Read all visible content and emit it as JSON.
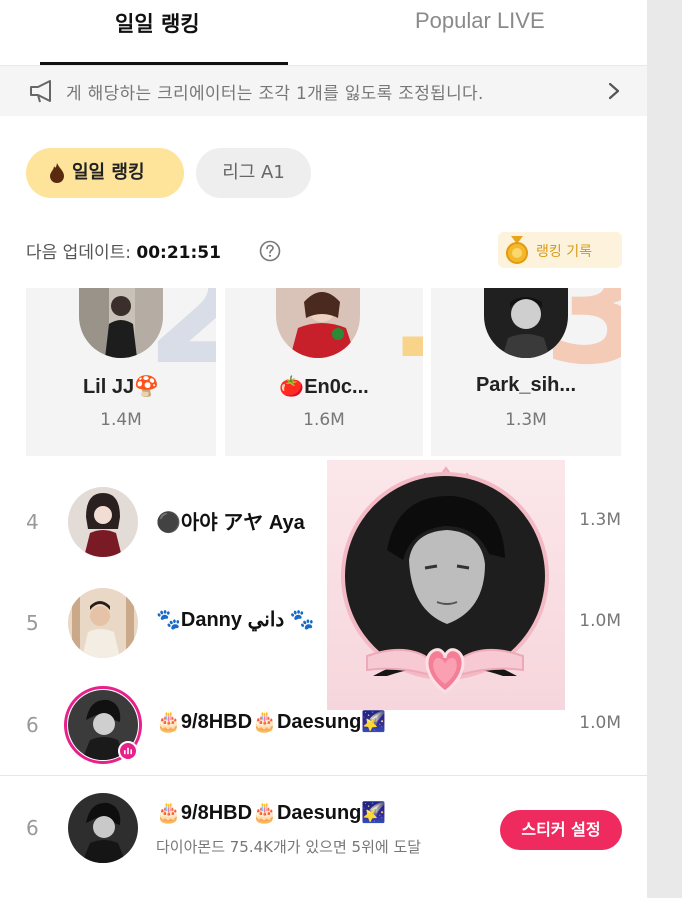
{
  "tabs": {
    "daily": "일일 랭킹",
    "popular": "Popular LIVE"
  },
  "notice": {
    "text": "게 해당하는 크리에이터는 조각 1개를 잃도록 조정됩니다."
  },
  "chips": {
    "daily": "일일 랭킹",
    "league": "리그 A1"
  },
  "update": {
    "label": "다음 업데이트:",
    "time": "00:21:51"
  },
  "ranking_record": "랭킹 기록",
  "top3": [
    {
      "rank": "2",
      "name": "Lil JJ🍄",
      "score": "1.4M"
    },
    {
      "rank": "1",
      "name": "🍅En0c...",
      "score": "1.6M"
    },
    {
      "rank": "3",
      "name": "Park_sih...",
      "score": "1.3M"
    }
  ],
  "rows": [
    {
      "rank": "4",
      "name": "⚫아야 アヤ Aya",
      "score": "1.3M"
    },
    {
      "rank": "5",
      "name": "🐾Danny داني 🐾",
      "score": "1.0M"
    },
    {
      "rank": "6",
      "name": "🎂9/8HBD🎂Daesung🌠",
      "score": "1.0M"
    }
  ],
  "me": {
    "rank": "6",
    "name": "🎂9/8HBD🎂Daesung🌠",
    "sub": "다이아몬드 75.4K개가 있으면 5위에 도달",
    "button": "스티커 설정"
  },
  "colors": {
    "accent_pink": "#ee2a5f",
    "live_ring": "#e8208c",
    "chip_yellow": "#fde49a",
    "gold": "#d89a16"
  }
}
